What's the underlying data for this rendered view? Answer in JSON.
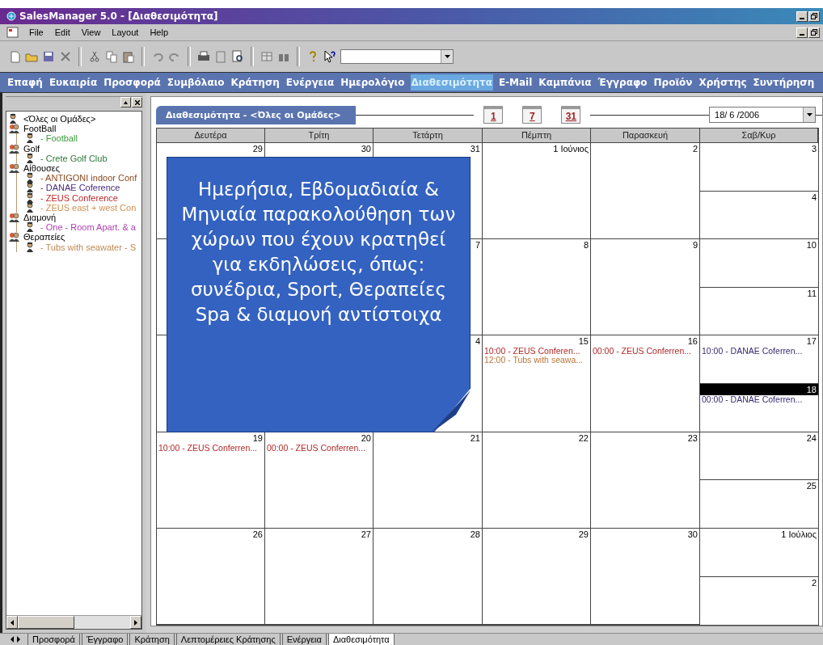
{
  "window": {
    "title": "SalesManager 5.0 - [Διαθεσιμότητα]"
  },
  "menu": [
    "File",
    "Edit",
    "View",
    "Layout",
    "Help"
  ],
  "navigation": [
    {
      "label": "Επαφή",
      "selected": false
    },
    {
      "label": "Ευκαιρία",
      "selected": false
    },
    {
      "label": "Προσφορά",
      "selected": false
    },
    {
      "label": "Συμβόλαιο",
      "selected": false
    },
    {
      "label": "Κράτηση",
      "selected": false
    },
    {
      "label": "Ενέργεια",
      "selected": false
    },
    {
      "label": "Ημερολόγιο",
      "selected": false
    },
    {
      "label": "Διαθεσιμότητα",
      "selected": true
    },
    {
      "label": "E-Mail",
      "selected": false
    },
    {
      "label": "Καμπάνια",
      "selected": false
    },
    {
      "label": "Έγγραφο",
      "selected": false
    },
    {
      "label": "Προϊόν",
      "selected": false
    },
    {
      "label": "Χρήστης",
      "selected": false
    },
    {
      "label": "Συντήρηση",
      "selected": false
    }
  ],
  "groups_tree": [
    {
      "label": "<Όλες οι Ομάδες>",
      "kind": "person"
    },
    {
      "label": "FootBall",
      "kind": "group",
      "children": [
        {
          "label": "- Football",
          "kind": "person",
          "color": "#3a9a3a"
        }
      ]
    },
    {
      "label": "Golf",
      "kind": "group",
      "children": [
        {
          "label": "- Crete Golf Club",
          "kind": "person",
          "color": "#2e7a3a"
        }
      ]
    },
    {
      "label": "Αίθουσες",
      "kind": "group",
      "children": [
        {
          "label": "- ANTIGONI indoor Conf",
          "kind": "person",
          "color": "#8a4a20"
        },
        {
          "label": "- DANAE Coference",
          "kind": "person",
          "color": "#4a2a80"
        },
        {
          "label": "- ZEUS Conference",
          "kind": "person",
          "color": "#c02828"
        },
        {
          "label": "- ZEUS east + west Con",
          "kind": "person",
          "color": "#d09050"
        }
      ]
    },
    {
      "label": "Διαμονή",
      "kind": "group",
      "children": [
        {
          "label": "- One - Room Apart. & a",
          "kind": "person",
          "color": "#b040b0"
        }
      ]
    },
    {
      "label": "Θεραπείες",
      "kind": "group",
      "children": [
        {
          "label": "- Tubs with seawater - S",
          "kind": "person",
          "color": "#c08850"
        }
      ]
    }
  ],
  "availability": {
    "title": "Διαθεσιμότητα - <Όλες οι Ομάδες>",
    "view_buttons": [
      "1",
      "7",
      "31"
    ],
    "date": "18/ 6 /2006",
    "weekdays": [
      "Δευτέρα",
      "Τρίτη",
      "Τετάρτη",
      "Πέμπτη",
      "Παρασκευή",
      "Σαβ/Κυρ"
    ],
    "weeks": [
      {
        "days": [
          {
            "date": "29",
            "selected": false
          },
          {
            "date": "30",
            "selected": false
          },
          {
            "date": "31",
            "selected": false
          },
          {
            "date": "1 Ιούνιος",
            "selected": false
          },
          {
            "date": "2",
            "selected": false
          }
        ],
        "weekend": [
          {
            "date": "3",
            "selected": false
          },
          {
            "date": "4",
            "selected": false
          }
        ]
      },
      {
        "days": [
          {
            "date": "7",
            "selected": false
          },
          {
            "date": "8",
            "selected": false
          },
          {
            "date": "9",
            "selected": false
          }
        ],
        "weekend": [
          {
            "date": "10",
            "selected": false
          },
          {
            "date": "11",
            "selected": false
          }
        ]
      },
      {
        "days": [
          {
            "date": "4",
            "selected": false
          },
          {
            "date": "15",
            "selected": false,
            "events": [
              {
                "text": "10:00 - ZEUS Conferen...",
                "color": "#b02828"
              },
              {
                "text": "12:00 - Tubs with seawa...",
                "color": "#b87438"
              }
            ]
          },
          {
            "date": "16",
            "selected": false,
            "events": [
              {
                "text": "00:00 - ZEUS Conferren...",
                "color": "#b02828"
              }
            ]
          }
        ],
        "weekend": [
          {
            "date": "17",
            "selected": false,
            "events": [
              {
                "text": "10:00 - DANAE Coferren...",
                "color": "#3a2a70"
              }
            ]
          },
          {
            "date": "18",
            "selected": true,
            "events": [
              {
                "text": "00:00 - DANAE Coferren...",
                "color": "#3a2a70"
              }
            ]
          }
        ]
      },
      {
        "days": [
          {
            "date": "19",
            "selected": false,
            "events": [
              {
                "text": "10:00 - ZEUS Conferren...",
                "color": "#b02828"
              }
            ]
          },
          {
            "date": "20",
            "selected": false,
            "events": [
              {
                "text": "00:00 - ZEUS Conferren...",
                "color": "#b02828"
              }
            ]
          },
          {
            "date": "21",
            "selected": false
          },
          {
            "date": "22",
            "selected": false
          },
          {
            "date": "23",
            "selected": false
          }
        ],
        "weekend": [
          {
            "date": "24",
            "selected": false
          },
          {
            "date": "25",
            "selected": false
          }
        ]
      },
      {
        "days": [
          {
            "date": "26",
            "selected": false
          },
          {
            "date": "27",
            "selected": false
          },
          {
            "date": "28",
            "selected": false
          },
          {
            "date": "29",
            "selected": false
          },
          {
            "date": "30",
            "selected": false
          }
        ],
        "weekend": [
          {
            "date": "1 Ιούλιος",
            "selected": false
          },
          {
            "date": "2",
            "selected": false
          }
        ]
      }
    ]
  },
  "callout": {
    "text": "Ημερήσια, Εβδομαδιαία & Μηνιαία παρακολούθηση των χώρων που έχουν κρατηθεί για εκδηλώσεις, όπως: συνέδρια, Sport, Θεραπείες Spa & διαμονή αντίστοιχα"
  },
  "bottom_tabs": [
    {
      "label": "Προσφορά",
      "selected": false
    },
    {
      "label": "Έγγραφο",
      "selected": false
    },
    {
      "label": "Κράτηση",
      "selected": false
    },
    {
      "label": "Λεπτομέρειες Κράτησης",
      "selected": false
    },
    {
      "label": "Ενέργεια",
      "selected": false
    },
    {
      "label": "Διαθεσιμότητα",
      "selected": true
    }
  ]
}
